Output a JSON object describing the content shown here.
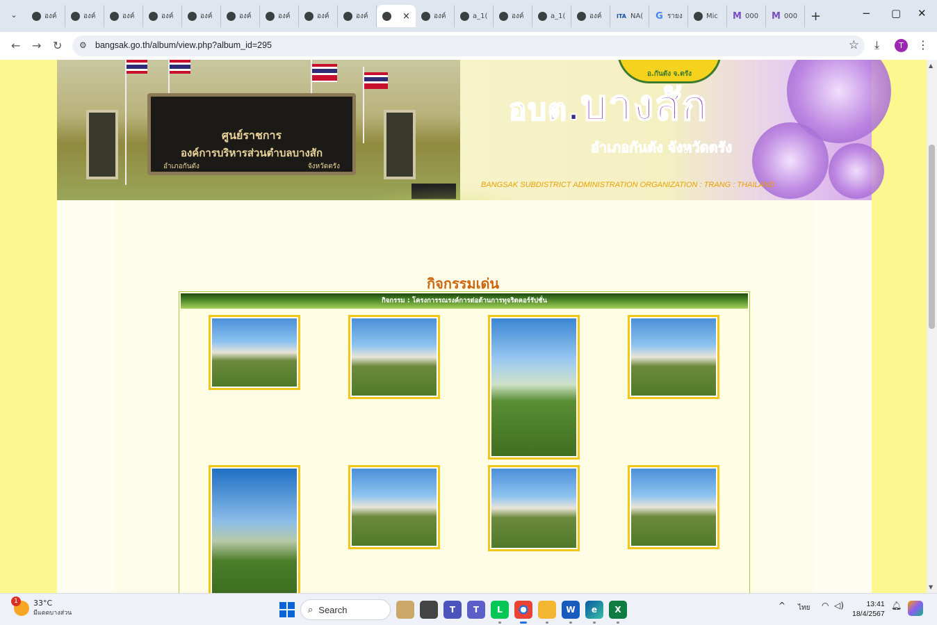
{
  "browser": {
    "tabs": [
      {
        "label": "องค์",
        "icon": "globe-icon"
      },
      {
        "label": "องค์",
        "icon": "globe-icon"
      },
      {
        "label": "องค์",
        "icon": "globe-icon"
      },
      {
        "label": "องค์",
        "icon": "globe-icon"
      },
      {
        "label": "องค์",
        "icon": "globe-icon"
      },
      {
        "label": "องค์",
        "icon": "globe-icon"
      },
      {
        "label": "องค์",
        "icon": "globe-icon"
      },
      {
        "label": "องค์",
        "icon": "globe-icon"
      },
      {
        "label": "องค์",
        "icon": "globe-icon"
      },
      {
        "label": "",
        "icon": "globe-icon",
        "active": true,
        "close": "×"
      },
      {
        "label": "องค์",
        "icon": "globe-icon"
      },
      {
        "label": "a_1(",
        "icon": "globe-icon"
      },
      {
        "label": "องค์",
        "icon": "globe-icon"
      },
      {
        "label": "a_1(",
        "icon": "globe-icon"
      },
      {
        "label": "องค์",
        "icon": "globe-icon"
      },
      {
        "label": "NA(",
        "icon": "ita-icon",
        "icon_text": "ITA"
      },
      {
        "label": "รายง",
        "icon": "google-icon",
        "icon_text": "G"
      },
      {
        "label": "Mic",
        "icon": "globe-icon"
      },
      {
        "label": "000",
        "icon": "m-icon",
        "icon_text": "M"
      },
      {
        "label": "000",
        "icon": "m-icon",
        "icon_text": "M"
      }
    ],
    "new_tab": "+",
    "window_controls": {
      "minimize": "−",
      "restore": "▢",
      "close": "✕"
    },
    "url": "bangsak.go.th/album/view.php?album_id=295",
    "profile_initial": "T"
  },
  "site": {
    "sign_line1": "ศูนย์ราชการ",
    "sign_line2": "องค์การบริหารส่วนตำบลบางสัก",
    "sign_district": "อำเภอกันตัง",
    "sign_province": "จังหวัดตรัง",
    "seal_text": "อ.กันตัง จ.ตรัง",
    "brand_prefix": "อบต.",
    "brand_name": "บางสัก",
    "brand_sub": "อำเภอกันตัง  จังหวัดตรัง",
    "brand_en": "BANGSAK  SUBDISTRICT ADMINISTRATION ORGANIZATION : TRANG : THAILAND"
  },
  "album": {
    "section_title": "กิจกรรมเด่น",
    "bar_title": "กิจกรรม : โครงการรณรงค์การต่อต้านการทุจริตคอร์รัปชั่น"
  },
  "taskbar": {
    "weather_temp": "33°C",
    "weather_desc": "มีแดดบางส่วน",
    "weather_badge": "1",
    "search_label": "Search",
    "lang": "ไทย",
    "time": "13:41",
    "date": "18/4/2567"
  }
}
